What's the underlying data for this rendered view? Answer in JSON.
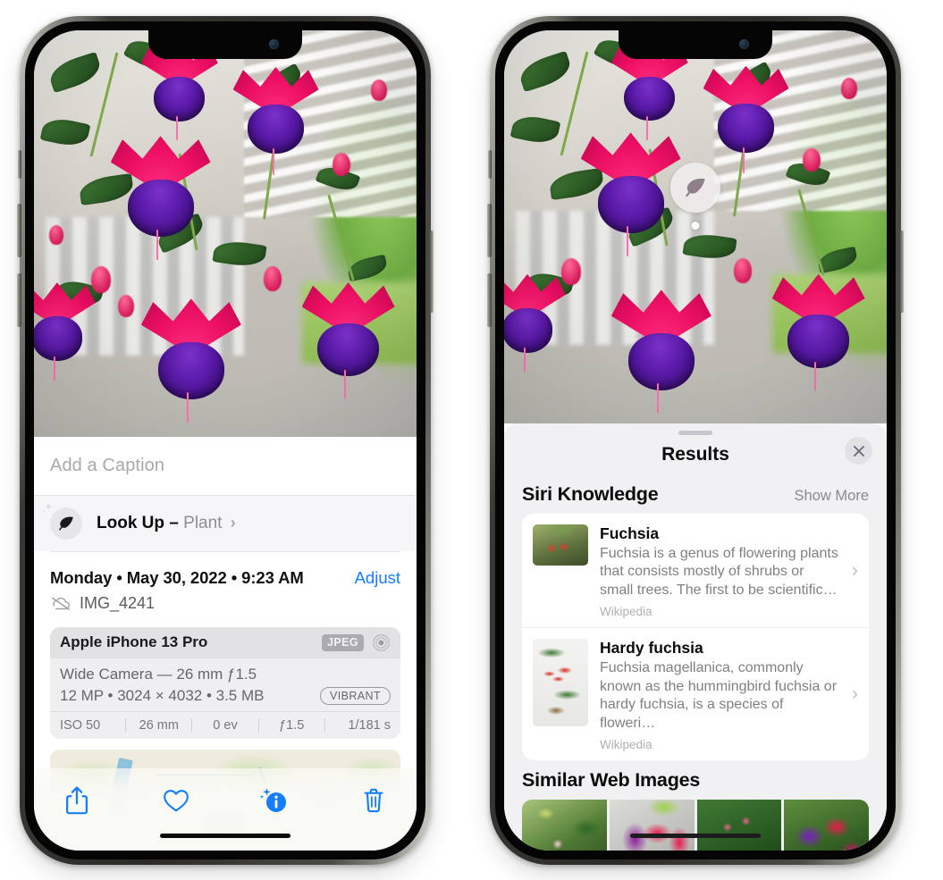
{
  "left_phone": {
    "caption_field": {
      "placeholder": "Add a Caption",
      "value": ""
    },
    "lookup_row": {
      "icon": "leaf-icon",
      "sparkle_icon": "sparkles-icon",
      "label": "Look Up",
      "dash": "–",
      "subject": "Plant",
      "chevron": "›"
    },
    "meta": {
      "date_line": "Monday • May 30, 2022 • 9:23 AM",
      "adjust_label": "Adjust",
      "cloud_icon": "cloud-slash-icon",
      "filename": "IMG_4241"
    },
    "exif": {
      "device": "Apple iPhone 13 Pro",
      "format_badge": "JPEG",
      "lens_icon": "aperture-icon",
      "lens_line": "Wide Camera — 26 mm ƒ1.5",
      "size_line": "12 MP • 3024 × 4032 • 3.5 MB",
      "style_badge": "VIBRANT",
      "stats": [
        "ISO 50",
        "26 mm",
        "0 ev",
        "ƒ1.5",
        "1/181 s"
      ]
    },
    "map": {
      "pin_label": "photo-thumbnail-pin"
    },
    "toolbar": {
      "items": [
        {
          "name": "share-button",
          "icon": "share-icon"
        },
        {
          "name": "favorite-button",
          "icon": "heart-icon"
        },
        {
          "name": "info-button",
          "icon": "info-sparkle-icon"
        },
        {
          "name": "delete-button",
          "icon": "trash-icon"
        }
      ],
      "accent_color": "#147efb"
    }
  },
  "right_phone": {
    "photo_badge": {
      "icon": "leaf-icon",
      "name": "visual-lookup-leaf-badge"
    },
    "sheet": {
      "title": "Results",
      "close_icon": "close-icon"
    },
    "siri_knowledge": {
      "section_title": "Siri Knowledge",
      "action_label": "Show More",
      "results": [
        {
          "title": "Fuchsia",
          "description": "Fuchsia is a genus of flowering plants that consists mostly of shrubs or small trees. The first to be scientific…",
          "source": "Wikipedia",
          "chevron": "›"
        },
        {
          "title": "Hardy fuchsia",
          "description": "Fuchsia magellanica, commonly known as the hummingbird fuchsia or hardy fuchsia, is a species of floweri…",
          "source": "Wikipedia",
          "chevron": "›"
        }
      ]
    },
    "similar_web_images": {
      "section_title": "Similar Web Images",
      "thumbnails": [
        "fuchsia-web-image-1",
        "fuchsia-web-image-2",
        "fuchsia-web-image-3",
        "fuchsia-web-image-4"
      ]
    }
  },
  "colors": {
    "accent_blue": "#147efb",
    "sheet_bg": "#f1f1f4",
    "card_bg": "#ffffff",
    "secondary_text": "#8e8e93"
  }
}
